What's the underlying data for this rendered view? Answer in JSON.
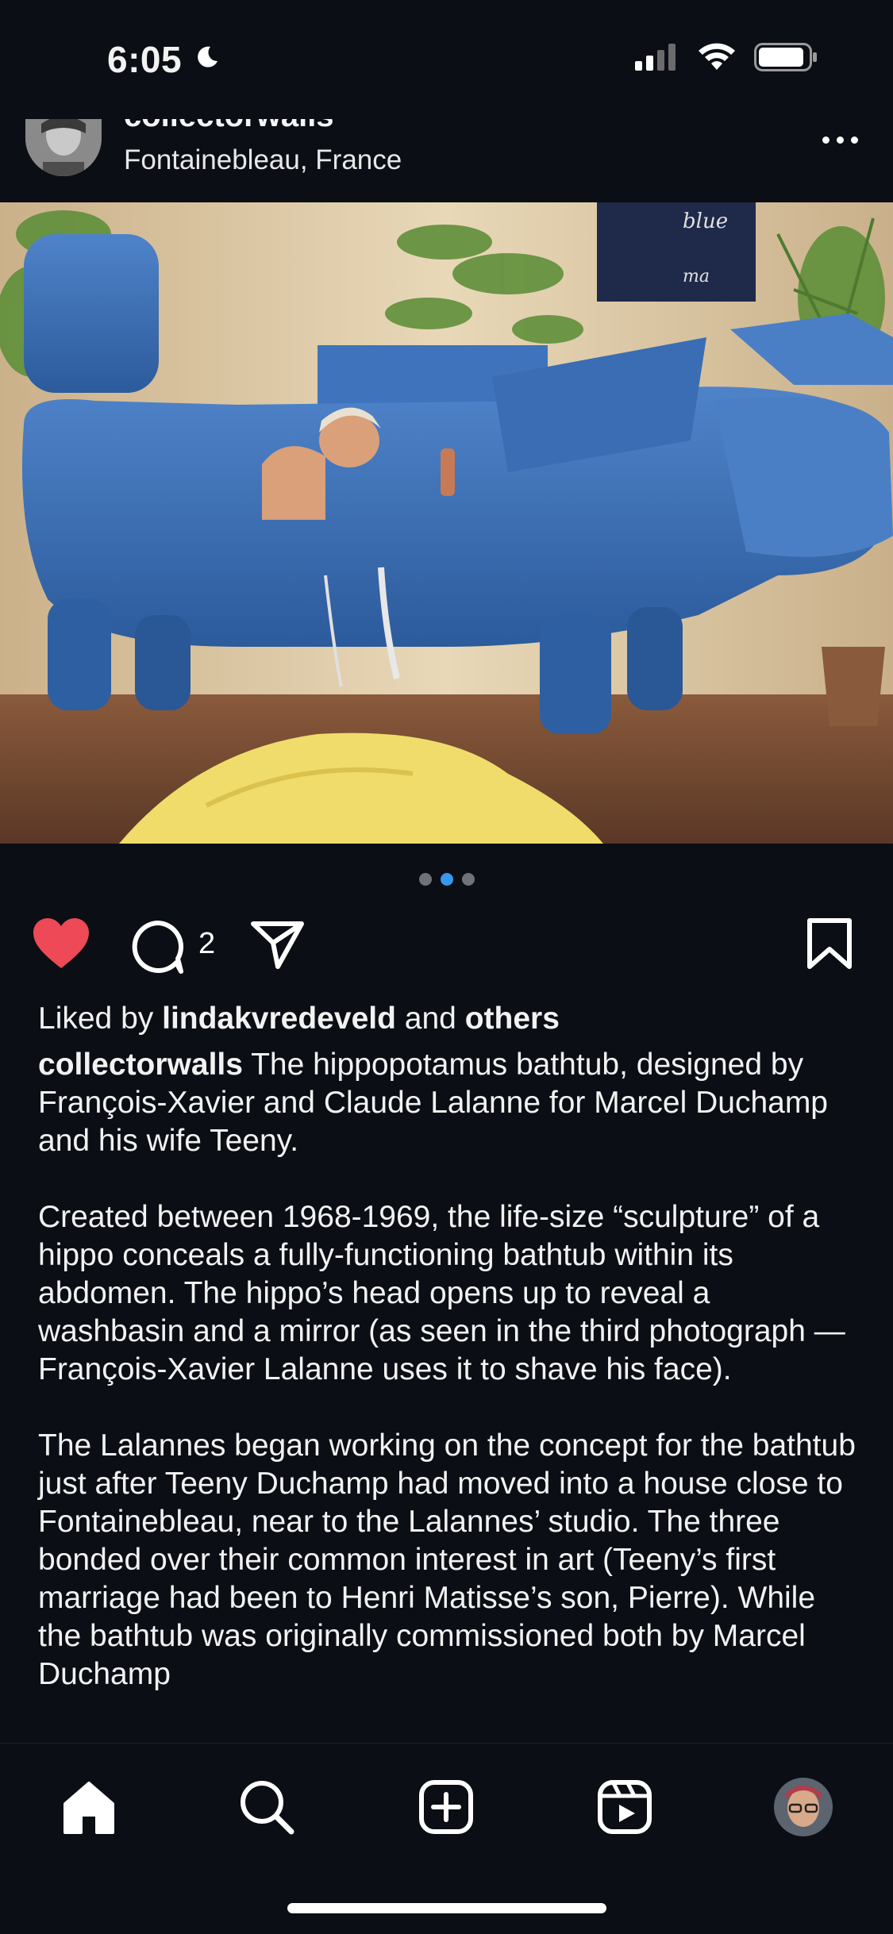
{
  "status_bar": {
    "time": "6:05"
  },
  "post": {
    "username": "collectorwalls",
    "location": "Fontainebleau, France",
    "carousel": {
      "count": 3,
      "active_index": 1
    },
    "liked": true,
    "comment_count": "2",
    "likes": {
      "prefix": "Liked by",
      "user": "lindakvredeveld",
      "conjunction": "and",
      "others": "others"
    },
    "caption": {
      "username": "collectorwalls",
      "p1": "The hippopotamus bathtub, designed by François-Xavier and Claude Lalanne for Marcel Duchamp and his wife Teeny.",
      "p2": "Created between 1968-1969, the life-size “sculpture” of a hippo conceals a fully-functioning bathtub within its abdomen. The hippo’s head opens up to reveal a washbasin and a mirror (as seen in the third photograph — François-Xavier Lalanne uses it to shave his face).",
      "p3": "The Lalannes began working on the concept for the bathtub just after Teeny Duchamp had moved into a house close to Fontainebleau, near to the Lalannes’ studio. The three bonded over their common interest in art (Teeny’s first marriage had been to Henri Matisse’s son, Pierre). While the bathtub was originally commissioned both by Marcel Duchamp"
    },
    "photo_sign": {
      "line1": "blue",
      "line2": "ma"
    }
  },
  "colors": {
    "like": "#ed4956",
    "accent": "#3897f0",
    "background": "#0b0e14"
  },
  "tab_bar": [
    "home-icon",
    "search-icon",
    "create-icon",
    "reels-icon",
    "profile-avatar"
  ]
}
